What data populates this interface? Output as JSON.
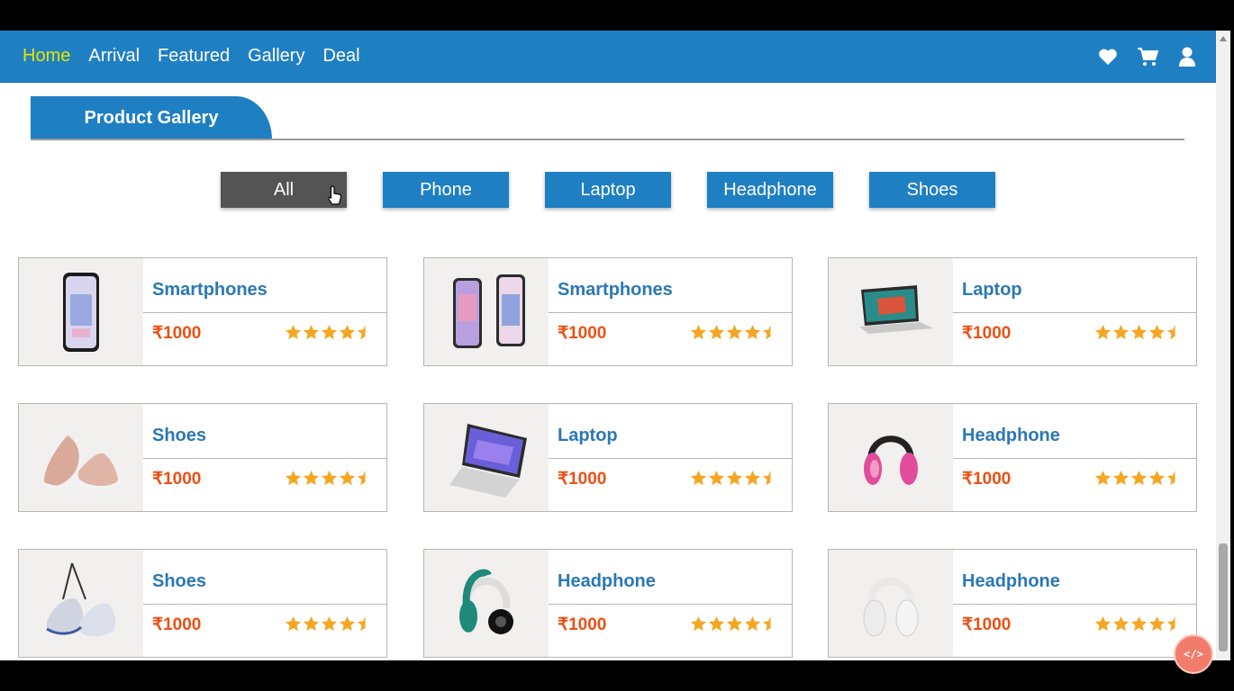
{
  "nav": {
    "links": [
      "Home",
      "Arrival",
      "Featured",
      "Gallery",
      "Deal"
    ],
    "icons": [
      "heart-icon",
      "cart-icon",
      "user-icon"
    ],
    "active_color": "#e6e600",
    "bar_color": "#1f7fc3"
  },
  "gallery": {
    "tab_title": "Product Gallery"
  },
  "filters": {
    "items": [
      "All",
      "Phone",
      "Laptop",
      "Headphone",
      "Shoes"
    ],
    "selected": "All"
  },
  "products": [
    {
      "title": "Smartphones",
      "price": "₹1000",
      "rating": 4.5,
      "image": "phone-image"
    },
    {
      "title": "Smartphones",
      "price": "₹1000",
      "rating": 4.5,
      "image": "phones-image"
    },
    {
      "title": "Laptop",
      "price": "₹1000",
      "rating": 4.5,
      "image": "laptop-image"
    },
    {
      "title": "Shoes",
      "price": "₹1000",
      "rating": 4.5,
      "image": "shoes-image"
    },
    {
      "title": "Laptop",
      "price": "₹1000",
      "rating": 4.5,
      "image": "laptop-open-image"
    },
    {
      "title": "Headphone",
      "price": "₹1000",
      "rating": 4.5,
      "image": "pink-headphone-image"
    },
    {
      "title": "Shoes",
      "price": "₹1000",
      "rating": 4.5,
      "image": "sneakers-image"
    },
    {
      "title": "Headphone",
      "price": "₹1000",
      "rating": 4.5,
      "image": "green-headphone-image"
    },
    {
      "title": "Headphone",
      "price": "₹1000",
      "rating": 4.5,
      "image": "white-headphone-image"
    }
  ],
  "code_badge": "</>"
}
